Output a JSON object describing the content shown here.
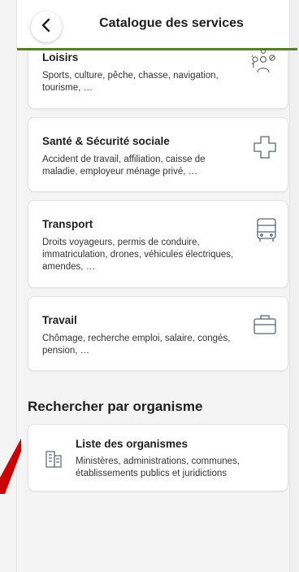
{
  "header": {
    "title": "Catalogue des services",
    "accent_color": "#5b7a2a"
  },
  "categories": [
    {
      "title": "Loisirs",
      "description": "Sports, culture, pêche, chasse, navigation, tourisme, …",
      "icon": "leisure-people-icon"
    },
    {
      "title": "Santé & Sécurité sociale",
      "description": "Accident de travail, affiliation, caisse de maladie, employeur ménage privé, …",
      "icon": "health-cross-icon"
    },
    {
      "title": "Transport",
      "description": "Droits voyageurs, permis de conduire, immatriculation, drones, véhicules électriques, amendes, …",
      "icon": "bus-icon"
    },
    {
      "title": "Travail",
      "description": "Chômage, recherche emploi, salaire, congés, pension, …",
      "icon": "briefcase-icon"
    }
  ],
  "organisms_section": {
    "title": "Rechercher par organisme",
    "item": {
      "title": "Liste des organismes",
      "description": "Ministères, administrations, communes, établissements publics et juridictions",
      "icon": "building-icon"
    }
  },
  "annotation": {
    "color": "#cc0000"
  }
}
